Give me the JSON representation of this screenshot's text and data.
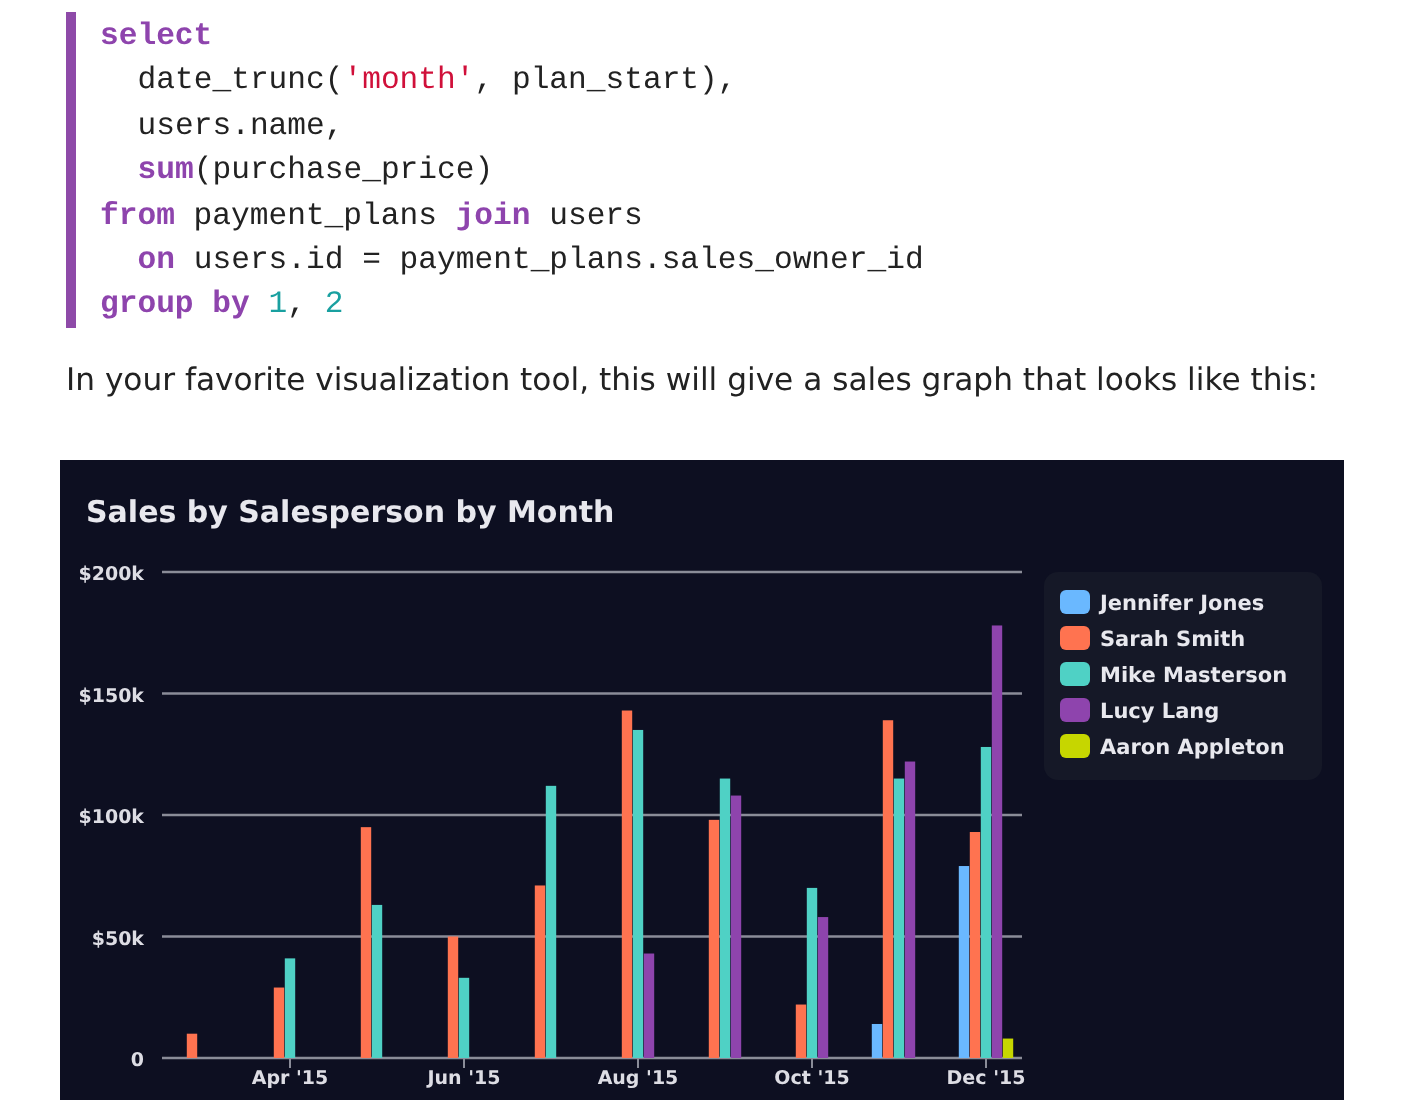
{
  "code": {
    "lines": [
      {
        "indent": false,
        "segments": [
          {
            "text": "select",
            "kind": "keyword"
          }
        ]
      },
      {
        "indent": true,
        "segments": [
          {
            "text": "date_trunc(",
            "kind": "plain"
          },
          {
            "text": "'month'",
            "kind": "string"
          },
          {
            "text": ", plan_start),",
            "kind": "plain"
          }
        ]
      },
      {
        "indent": true,
        "segments": [
          {
            "text": "users.name,",
            "kind": "plain"
          }
        ]
      },
      {
        "indent": true,
        "segments": [
          {
            "text": "sum",
            "kind": "keyword"
          },
          {
            "text": "(purchase_price)",
            "kind": "plain"
          }
        ]
      },
      {
        "indent": false,
        "segments": [
          {
            "text": "from",
            "kind": "keyword"
          },
          {
            "text": " payment_plans ",
            "kind": "plain"
          },
          {
            "text": "join",
            "kind": "keyword"
          },
          {
            "text": " users",
            "kind": "plain"
          }
        ]
      },
      {
        "indent": true,
        "segments": [
          {
            "text": "on",
            "kind": "keyword"
          },
          {
            "text": " users.id = payment_plans.sales_owner_id",
            "kind": "plain"
          }
        ]
      },
      {
        "indent": false,
        "segments": [
          {
            "text": "group by ",
            "kind": "keyword"
          },
          {
            "text": "1",
            "kind": "number"
          },
          {
            "text": ", ",
            "kind": "plain"
          },
          {
            "text": "2",
            "kind": "number"
          }
        ]
      }
    ]
  },
  "paragraph": "In your favorite visualization tool, this will give a sales graph that looks like this:",
  "chart": {
    "chart_data": {
      "type": "bar",
      "title": "Sales by Salesperson by Month",
      "stacked": false,
      "grid": true,
      "legend": "right",
      "categories": [
        null,
        "Apr '15",
        null,
        "Jun '15",
        null,
        "Aug '15",
        null,
        "Oct '15",
        null,
        "Dec '15"
      ],
      "ylim": [
        0,
        200000
      ],
      "yticks": [
        {
          "value": 0,
          "label": "0"
        },
        {
          "value": 50000,
          "label": "$50k"
        },
        {
          "value": 100000,
          "label": "$100k"
        },
        {
          "value": 150000,
          "label": "$150k"
        },
        {
          "value": 200000,
          "label": "$200k"
        }
      ],
      "series": [
        {
          "name": "Jennifer Jones",
          "color": "#6ab8ff",
          "values": [
            null,
            null,
            null,
            null,
            null,
            null,
            null,
            null,
            14000,
            79000
          ]
        },
        {
          "name": "Sarah Smith",
          "color": "#ff7350",
          "values": [
            10000,
            29000,
            95000,
            50000,
            71000,
            143000,
            98000,
            22000,
            139000,
            93000
          ]
        },
        {
          "name": "Mike Masterson",
          "color": "#4fd1c5",
          "values": [
            null,
            41000,
            63000,
            33000,
            112000,
            135000,
            115000,
            70000,
            115000,
            128000
          ]
        },
        {
          "name": "Lucy Lang",
          "color": "#8e44ad",
          "values": [
            null,
            null,
            null,
            null,
            null,
            43000,
            108000,
            58000,
            122000,
            178000
          ]
        },
        {
          "name": "Aaron Appleton",
          "color": "#c6d600",
          "values": [
            null,
            null,
            null,
            null,
            null,
            null,
            null,
            null,
            null,
            8000
          ]
        }
      ]
    }
  }
}
